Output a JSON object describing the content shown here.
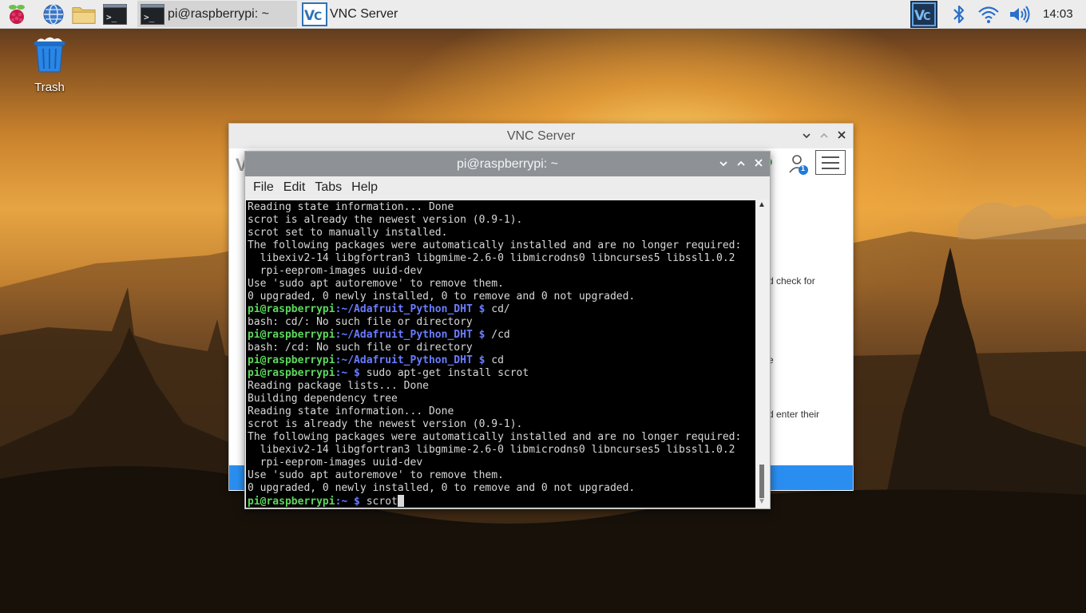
{
  "taskbar": {
    "tasks": [
      {
        "label": "pi@raspberrypi: ~",
        "icon": "terminal-icon"
      },
      {
        "label": "VNC Server",
        "icon": "vnc-icon"
      }
    ],
    "clock": "14:03",
    "launchers": [
      "raspberry-menu-icon",
      "web-browser-icon",
      "file-manager-icon",
      "terminal-icon"
    ],
    "tray": [
      "vnc-tray-icon",
      "bluetooth-icon",
      "wifi-icon",
      "volume-icon"
    ]
  },
  "desktop": {
    "icons": [
      {
        "label": "Trash",
        "icon": "trash-icon"
      }
    ]
  },
  "vnc_window": {
    "title": "VNC Server",
    "user_badge": "1",
    "side_texts": [
      "d check for",
      "e",
      "d enter their"
    ],
    "colors": {
      "accent": "#2a8ef0"
    }
  },
  "terminal": {
    "title": "pi@raspberrypi: ~",
    "menu": [
      "File",
      "Edit",
      "Tabs",
      "Help"
    ],
    "lines": [
      {
        "text": "Reading state information... Done"
      },
      {
        "text": "scrot is already the newest version (0.9-1)."
      },
      {
        "text": "scrot set to manually installed."
      },
      {
        "text": "The following packages were automatically installed and are no longer required:"
      },
      {
        "text": "  libexiv2-14 libgfortran3 libgmime-2.6-0 libmicrodns0 libncurses5 libssl1.0.2"
      },
      {
        "text": "  rpi-eeprom-images uuid-dev"
      },
      {
        "text": "Use 'sudo apt autoremove' to remove them."
      },
      {
        "text": "0 upgraded, 0 newly installed, 0 to remove and 0 not upgraded."
      },
      {
        "user": "pi@raspberrypi",
        "path": ":~/Adafruit_Python_DHT $",
        "cmd": " cd/"
      },
      {
        "text": "bash: cd/: No such file or directory"
      },
      {
        "user": "pi@raspberrypi",
        "path": ":~/Adafruit_Python_DHT $",
        "cmd": " /cd"
      },
      {
        "text": "bash: /cd: No such file or directory"
      },
      {
        "user": "pi@raspberrypi",
        "path": ":~/Adafruit_Python_DHT $",
        "cmd": " cd"
      },
      {
        "user": "pi@raspberrypi",
        "path": ":~ $",
        "cmd": " sudo apt-get install scrot"
      },
      {
        "text": "Reading package lists... Done"
      },
      {
        "text": "Building dependency tree"
      },
      {
        "text": "Reading state information... Done"
      },
      {
        "text": "scrot is already the newest version (0.9-1)."
      },
      {
        "text": "The following packages were automatically installed and are no longer required:"
      },
      {
        "text": "  libexiv2-14 libgfortran3 libgmime-2.6-0 libmicrodns0 libncurses5 libssl1.0.2"
      },
      {
        "text": "  rpi-eeprom-images uuid-dev"
      },
      {
        "text": "Use 'sudo apt autoremove' to remove them."
      },
      {
        "text": "0 upgraded, 0 newly installed, 0 to remove and 0 not upgraded."
      },
      {
        "user": "pi@raspberrypi",
        "path": ":~ $",
        "cmd": " scrot",
        "cursor": true
      }
    ]
  }
}
